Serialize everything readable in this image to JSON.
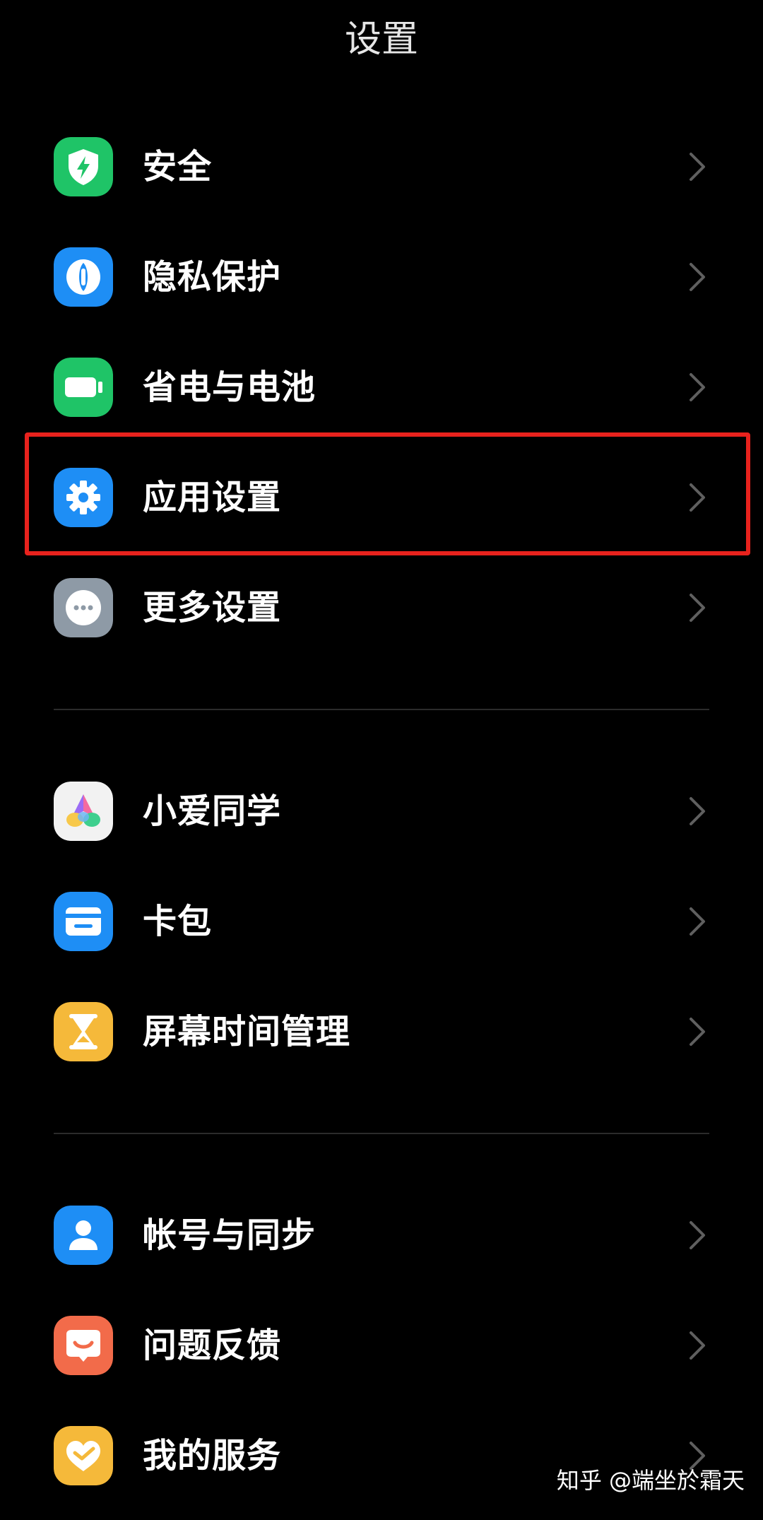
{
  "header": {
    "title": "设置"
  },
  "groups": [
    {
      "items": [
        {
          "label": "安全",
          "icon": "shield-icon",
          "color": "#1fc467"
        },
        {
          "label": "隐私保护",
          "icon": "privacy-icon",
          "color": "#1e8ef5"
        },
        {
          "label": "省电与电池",
          "icon": "battery-icon",
          "color": "#1fc467"
        },
        {
          "label": "应用设置",
          "icon": "gear-icon",
          "color": "#1e8ef5"
        },
        {
          "label": "更多设置",
          "icon": "more-icon",
          "color": "#8e9aa6"
        }
      ]
    },
    {
      "items": [
        {
          "label": "小爱同学",
          "icon": "xiaoai-icon",
          "color": "#f2f2f2"
        },
        {
          "label": "卡包",
          "icon": "card-wallet-icon",
          "color": "#1e8ef5"
        },
        {
          "label": "屏幕时间管理",
          "icon": "hourglass-icon",
          "color": "#f5b93a"
        }
      ]
    },
    {
      "items": [
        {
          "label": "帐号与同步",
          "icon": "account-icon",
          "color": "#1e8ef5"
        },
        {
          "label": "问题反馈",
          "icon": "feedback-icon",
          "color": "#f26b4a"
        },
        {
          "label": "我的服务",
          "icon": "heart-icon",
          "color": "#f5b93a"
        }
      ]
    }
  ],
  "highlight": {
    "target": "应用设置",
    "color": "#e8221d"
  },
  "watermark": {
    "text": "知乎 @端坐於霜天"
  }
}
